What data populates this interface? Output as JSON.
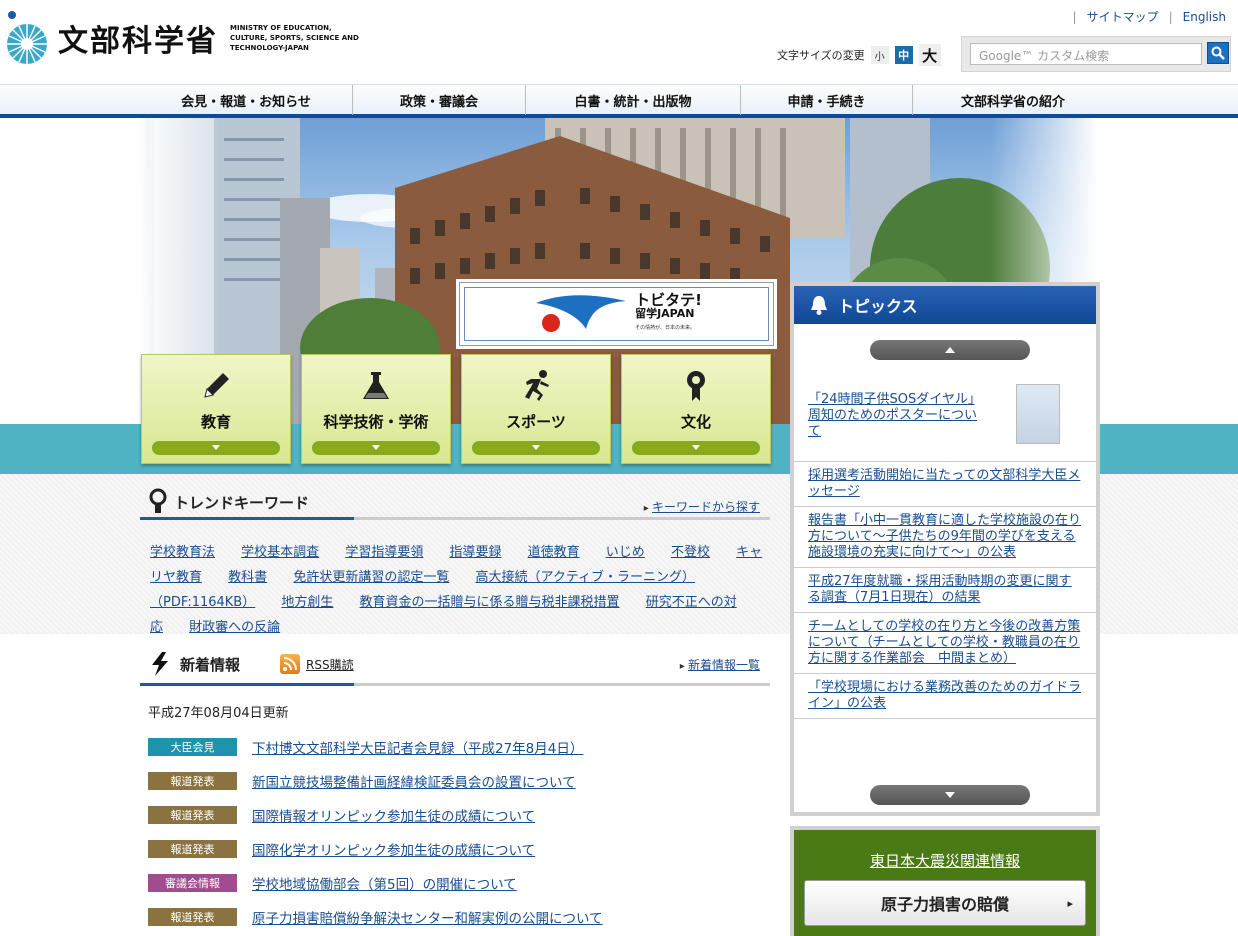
{
  "header": {
    "logo_jp": "文部科学省",
    "logo_en": "MINISTRY OF EDUCATION, CULTURE, SPORTS, SCIENCE AND TECHNOLOGY-JAPAN",
    "top_links": [
      "サイトマップ",
      "English"
    ],
    "font_size_label": "文字サイズの変更",
    "font_sizes": [
      "小",
      "中",
      "大"
    ],
    "search_placeholder": "Google™ カスタム検索"
  },
  "nav": {
    "items": [
      "会見・報道・お知らせ",
      "政策・審議会",
      "白書・統計・出版物",
      "申請・手続き",
      "文部科学省の紹介"
    ]
  },
  "hero": {
    "banner_title": "トビタテ!",
    "banner_sub": "留学JAPAN",
    "banner_tag": "その情熱が、日本の未来。"
  },
  "categories": [
    "教育",
    "科学技術・学術",
    "スポーツ",
    "文化"
  ],
  "keywords": {
    "title": "トレンドキーワード",
    "more": "キーワードから探す",
    "items": [
      "学校教育法",
      "学校基本調査",
      "学習指導要領",
      "指導要録",
      "道徳教育",
      "いじめ",
      "不登校",
      "キャリヤ教育",
      "教科書",
      "免許状更新講習の認定一覧",
      "高大接続（アクティブ・ラーニング）（PDF:1164KB）",
      "地方創生",
      "教育資金の一括贈与に係る贈与税非課税措置",
      "研究不正への対応",
      "財政審への反論"
    ]
  },
  "news": {
    "title": "新着情報",
    "rss": "RSS購読",
    "more": "新着情報一覧",
    "date": "平成27年08月04日更新",
    "items": [
      {
        "badge": "大臣会見",
        "color": "#1f92ad",
        "text": "下村博文文部科学大臣記者会見録（平成27年8月4日）"
      },
      {
        "badge": "報道発表",
        "color": "#8a7341",
        "text": "新国立競技場整備計画経緯検証委員会の設置について"
      },
      {
        "badge": "報道発表",
        "color": "#8a7341",
        "text": "国際情報オリンピック参加生徒の成績について"
      },
      {
        "badge": "報道発表",
        "color": "#8a7341",
        "text": "国際化学オリンピック参加生徒の成績について"
      },
      {
        "badge": "審議会情報",
        "color": "#a24b8f",
        "text": "学校地域協働部会（第5回）の開催について"
      },
      {
        "badge": "報道発表",
        "color": "#8a7341",
        "text": "原子力損害賠償紛争解決センター和解実例の公開について"
      }
    ]
  },
  "topics": {
    "title": "トピックス",
    "items": [
      "「24時間子供SOSダイヤル」周知のためのポスターについて",
      "採用選考活動開始に当たっての文部科学大臣メッセージ",
      "報告書「小中一貫教育に適した学校施設の在り方について～子供たちの9年間の学びを支える施設環境の充実に向けて～」の公表",
      "平成27年度就職・採用活動時期の変更に関する調査（7月1日現在）の結果",
      "チームとしての学校の在り方と今後の改善方策について（チームとしての学校・教職員の在り方に関する作業部会　中間まとめ）",
      "「学校現場における業務改善のためのガイドライン」の公表"
    ]
  },
  "quake": {
    "link": "東日本大震災関連情報",
    "button": "原子力損害の賠償"
  }
}
